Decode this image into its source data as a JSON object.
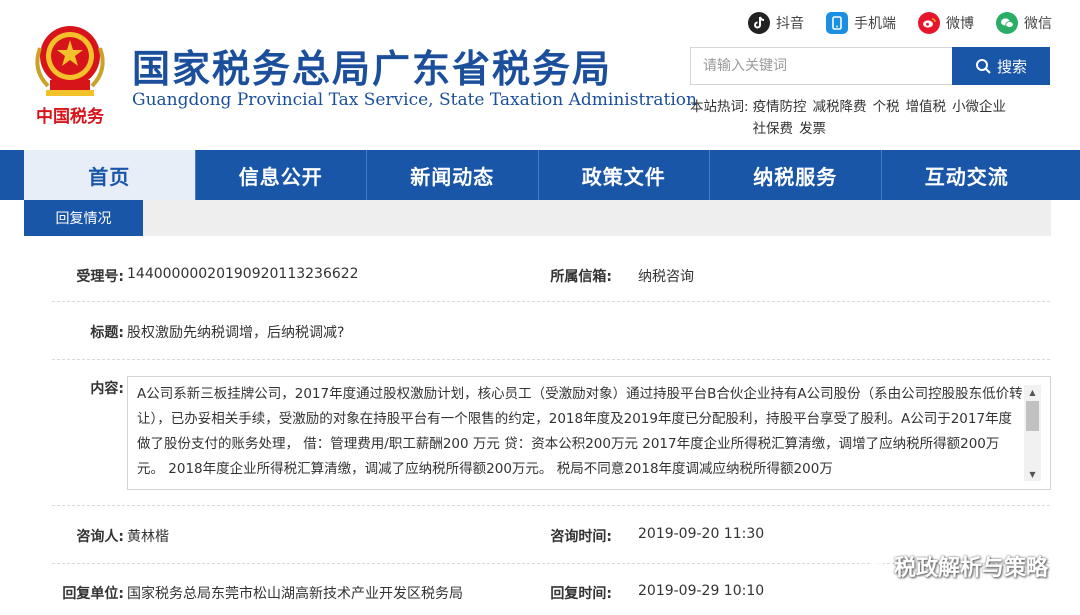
{
  "header": {
    "title": "国家税务总局广东省税务局",
    "subtitle": "Guangdong Provincial Tax Service, State Taxation Administration",
    "emblem_text": "中国税务"
  },
  "social": [
    {
      "label": "抖音",
      "icon": "douyin-icon",
      "color": "#222222"
    },
    {
      "label": "手机端",
      "icon": "mobile-icon",
      "color": "#1a8fe3"
    },
    {
      "label": "微博",
      "icon": "weibo-icon",
      "color": "#e6162d"
    },
    {
      "label": "微信",
      "icon": "wechat-icon",
      "color": "#2aae67"
    }
  ],
  "search": {
    "placeholder": "请输入关键词",
    "button_label": "搜索"
  },
  "hotwords": {
    "label": "本站热词:",
    "items": [
      "疫情防控",
      "减税降费",
      "个税",
      "增值税",
      "小微企业",
      "社保费",
      "发票"
    ]
  },
  "nav": {
    "items": [
      "首页",
      "信息公开",
      "新闻动态",
      "政策文件",
      "纳税服务",
      "互动交流"
    ],
    "active_index": 0
  },
  "subnav": {
    "tab_label": "回复情况"
  },
  "record": {
    "id_label": "受理号:",
    "id_value": "1440000002019092011323 6622",
    "mailbox_label": "所属信箱:",
    "mailbox_value": "纳税咨询",
    "title_label": "标题:",
    "title_value": "股权激励先纳税调增，后纳税调减?",
    "content_label": "内容:",
    "content_value": "A公司系新三板挂牌公司，2017年度通过股权激励计划，核心员工（受激励对象）通过持股平台B合伙企业持有A公司股份（系由公司控股股东低价转让），已办妥相关手续，受激励的对象在持股平台有一个限售的约定，2018年度及2019年度已分配股利，持股平台享受了股利。A公司于2017年度做了股份支付的账务处理， 借：管理费用/职工薪酬200 万元 贷：资本公积200万元 2017年度企业所得税汇算清缴，调增了应纳税所得额200万元。 2018年度企业所得税汇算清缴，调减了应纳税所得额200万元。 税局不同意2018年度调减应纳税所得额200万",
    "asker_label": "咨询人:",
    "asker_value": "黄林楷",
    "ask_time_label": "咨询时间:",
    "ask_time_value": "2019-09-20 11:30",
    "reply_unit_label": "回复单位:",
    "reply_unit_value": "国家税务总局东莞市松山湖高新技术产业开发区税务局",
    "reply_time_label": "回复时间:",
    "reply_time_value": "2019-09-29 10:10"
  },
  "watermark": {
    "text": "税政解析与策略"
  },
  "colors": {
    "brand_blue": "#1a56a8",
    "title_blue": "#1b4f9c",
    "emblem_red": "#d7141a"
  }
}
